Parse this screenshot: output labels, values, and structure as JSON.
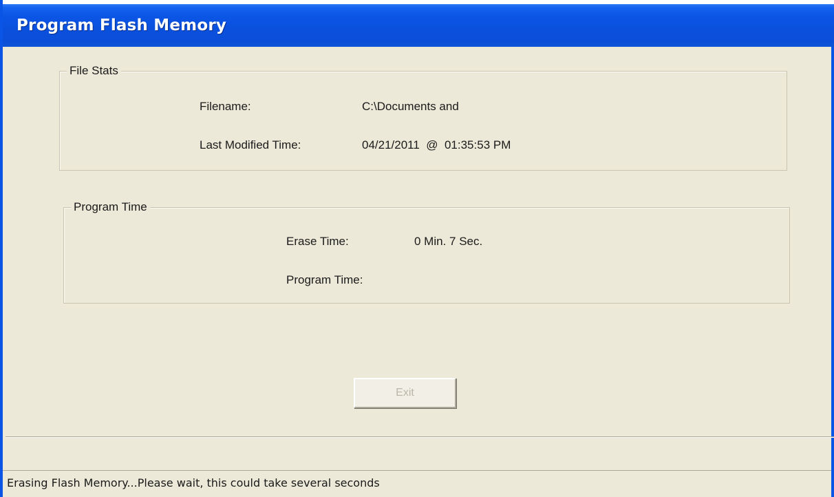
{
  "window": {
    "title": "Program Flash Memory"
  },
  "file_stats": {
    "legend": "File Stats",
    "filename_label": "Filename:",
    "filename_value": "C:\\Documents and",
    "modified_label": "Last Modified Time:",
    "modified_value": "04/21/2011  @  01:35:53 PM"
  },
  "program_time": {
    "legend": "Program Time",
    "erase_label": "Erase Time:",
    "erase_value": "0 Min. 7 Sec.",
    "program_label": "Program Time:",
    "program_value": ""
  },
  "actions": {
    "exit_label": "Exit",
    "exit_enabled": false
  },
  "status": {
    "text": "Erasing Flash Memory...Please wait, this could take several seconds"
  },
  "colors": {
    "titlebar": "#0a50de",
    "dialog_background": "#ece9d8",
    "disabled_text": "#b9b6a8"
  }
}
